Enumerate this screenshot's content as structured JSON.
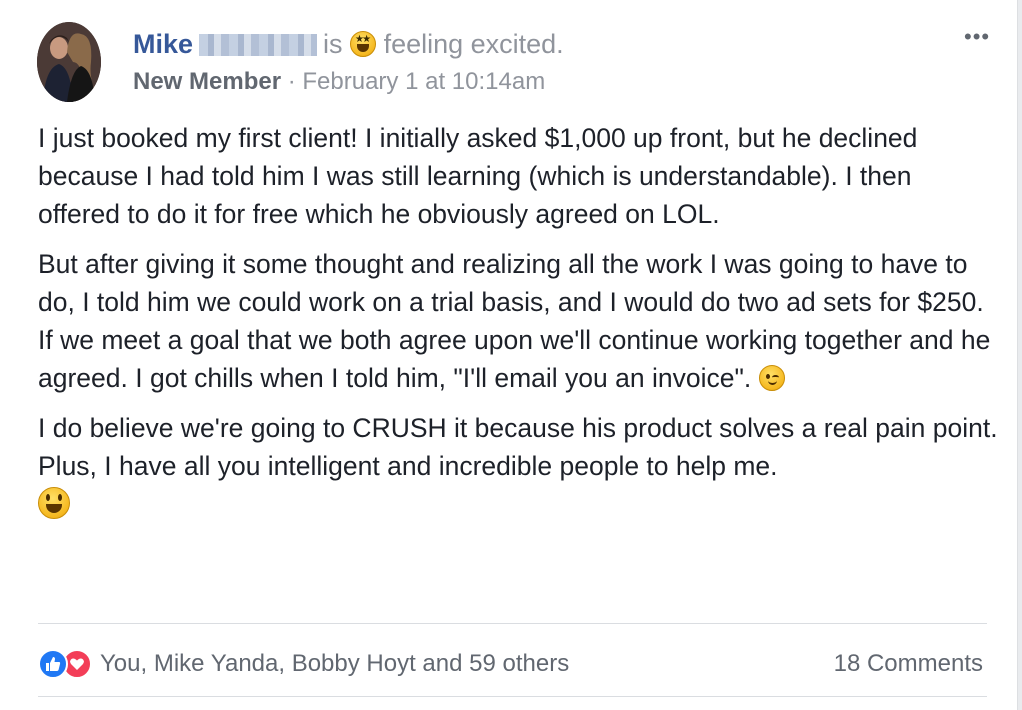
{
  "post": {
    "author_name": "Mike",
    "verb": "is",
    "activity": "feeling excited.",
    "badge": "New Member",
    "separator": "·",
    "timestamp": "February 1 at 10:14am",
    "menu_label": "•••",
    "paragraphs": {
      "p1": "I just booked my first client! I initially asked $1,000 up front, but he declined because I had told him I was still learning (which is understandable). I then offered to do it for free which he obviously agreed on LOL.",
      "p2": "But after giving it some thought and realizing all the work I was going to have to do, I told him we could work on a trial basis, and I would do two ad sets for $250. If we meet a goal that we both agree upon we'll continue working together and he agreed. I got chills when I told him, \"I'll email you an invoice\".",
      "p3": "I do believe we're going to CRUSH it because his product solves a real pain point. Plus, I have all you intelligent and incredible people to help me."
    }
  },
  "footer": {
    "likers": "You, Mike Yanda, Bobby Hoyt and 59 others",
    "comments": "18 Comments"
  },
  "icons": {
    "feeling": "star-struck-emoji-icon",
    "wink": "wink-emoji-icon",
    "grin": "grin-emoji-icon",
    "like": "like-reaction-icon",
    "love": "love-reaction-icon"
  },
  "colors": {
    "author": "#365899",
    "secondary_text": "#90949c",
    "body_text": "#1d2129",
    "like": "#2078f4",
    "love": "#f33e58"
  }
}
